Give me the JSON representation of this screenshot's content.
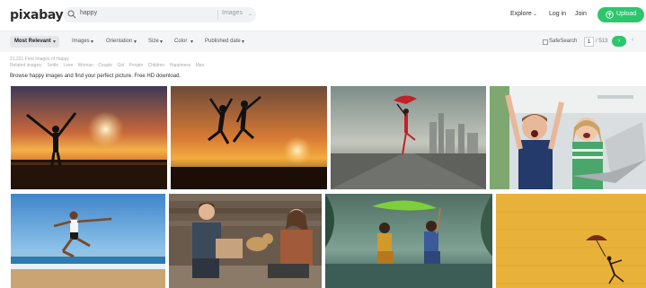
{
  "header": {
    "logo": "pixabay",
    "search_value": "happy",
    "search_type": "Images",
    "explore": "Explore",
    "login": "Log in",
    "join": "Join",
    "upload": "Upload"
  },
  "filters": {
    "sort": "Most Relevant",
    "items": [
      "Images",
      "Orientation",
      "Size",
      "Color",
      "Published date"
    ],
    "safesearch": "SafeSearch",
    "page": "1",
    "page_total": "/ 513"
  },
  "results": {
    "count": "21,221 Free images of Happy",
    "related_label": "Related images:",
    "related": [
      "Smile",
      "Love",
      "Woman",
      "Couple",
      "Girl",
      "People",
      "Children",
      "Happiness",
      "Man"
    ],
    "tagline": "Browse happy images and find your perfect picture. Free HD download."
  },
  "colors": {
    "accent": "#2ec66d",
    "filter_bg": "#f4f5f7"
  },
  "images": [
    {
      "name": "woman-sunset-silhouette-image",
      "subject": "woman silhouette at sunset"
    },
    {
      "name": "jumping-couple-sunset-image",
      "subject": "couple jumping at sunset"
    },
    {
      "name": "dancer-umbrella-city-image",
      "subject": "woman with red umbrella"
    },
    {
      "name": "kids-laptop-image",
      "subject": "children with laptop"
    },
    {
      "name": "beach-jump-woman-image",
      "subject": "woman jumping on beach"
    },
    {
      "name": "couple-dog-image",
      "subject": "couple with dog"
    },
    {
      "name": "children-leaf-rain-image",
      "subject": "children under leaf"
    },
    {
      "name": "yellow-wall-umbrella-image",
      "subject": "figure with umbrella on yellow wall"
    }
  ]
}
